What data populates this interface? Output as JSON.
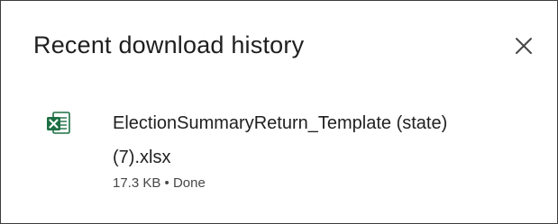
{
  "panel": {
    "title": "Recent download history",
    "close_icon": "close-icon"
  },
  "downloads": [
    {
      "file_name": "ElectionSummaryReturn_Template (state) (7).xlsx",
      "meta": "17.3 KB • Done",
      "icon": "excel-file-icon"
    }
  ],
  "colors": {
    "excel_green": "#1d7044",
    "text_primary": "#1f1f1f",
    "text_secondary": "#474747",
    "border": "#3c3c3c"
  }
}
